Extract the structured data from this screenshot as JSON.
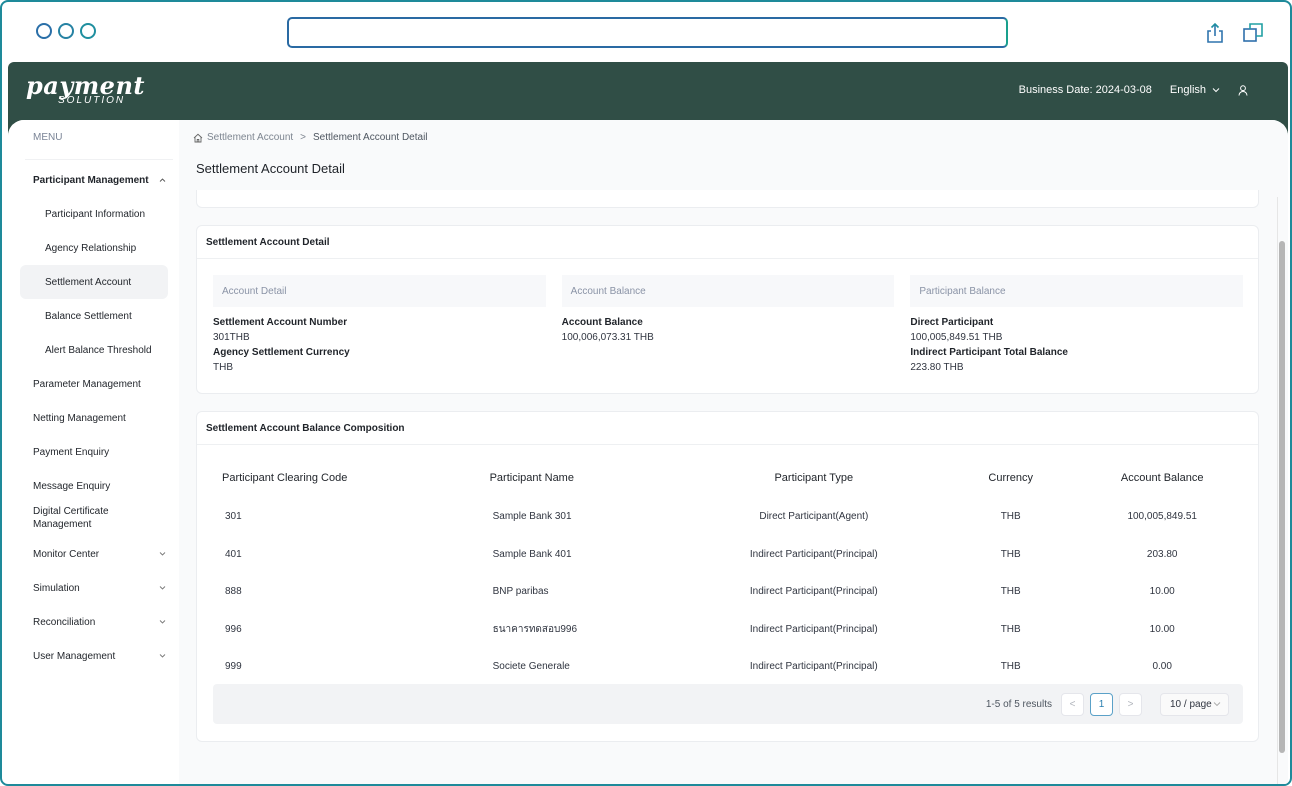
{
  "browser": {
    "url": "",
    "icons": [
      "share-icon",
      "windows-icon"
    ]
  },
  "header": {
    "logo_line1": "payment",
    "logo_line2": "SOLUTION",
    "business_date": "Business Date: 2024-03-08",
    "language": "English",
    "icons": [
      "chevron-down-icon",
      "user-icon"
    ]
  },
  "sidebar": {
    "menu_label": "MENU",
    "items": [
      {
        "label": "Participant Management",
        "level": 0,
        "expanded": true
      },
      {
        "label": "Participant Information",
        "level": 1
      },
      {
        "label": "Agency Relationship",
        "level": 1
      },
      {
        "label": "Settlement Account",
        "level": 1,
        "active": true
      },
      {
        "label": "Balance Settlement",
        "level": 1
      },
      {
        "label": "Alert Balance Threshold",
        "level": 1
      },
      {
        "label": "Parameter Management",
        "level": 0
      },
      {
        "label": "Netting Management",
        "level": 0
      },
      {
        "label": "Payment Enquiry",
        "level": 0
      },
      {
        "label": "Message Enquiry",
        "level": 0
      },
      {
        "label": "Digital Certificate Management",
        "level": 0
      },
      {
        "label": "Monitor Center",
        "level": 0,
        "expandable": true
      },
      {
        "label": "Simulation",
        "level": 0,
        "expandable": true
      },
      {
        "label": "Reconciliation",
        "level": 0,
        "expandable": true
      },
      {
        "label": "User Management",
        "level": 0,
        "expandable": true
      }
    ]
  },
  "breadcrumb": {
    "items": [
      "Settlement Account",
      "Settlement Account Detail"
    ],
    "separator": ">"
  },
  "page": {
    "title": "Settlement Account Detail"
  },
  "detail_card": {
    "title": "Settlement Account Detail",
    "sections": [
      {
        "heading": "Account Detail",
        "fields": [
          {
            "label": "Settlement Account Number",
            "value": "301THB"
          },
          {
            "label": "Agency Settlement Currency",
            "value": "THB"
          }
        ]
      },
      {
        "heading": "Account Balance",
        "fields": [
          {
            "label": "Account Balance",
            "value": "100,006,073.31 THB"
          }
        ]
      },
      {
        "heading": "Participant Balance",
        "fields": [
          {
            "label": "Direct Participant",
            "value": "100,005,849.51 THB"
          },
          {
            "label": "Indirect Participant Total Balance",
            "value": "223.80 THB"
          }
        ]
      }
    ]
  },
  "composition_card": {
    "title": "Settlement Account Balance Composition",
    "columns": [
      "Participant Clearing Code",
      "Participant Name",
      "Participant Type",
      "Currency",
      "Account Balance"
    ],
    "rows": [
      [
        "301",
        "Sample Bank 301",
        "Direct Participant(Agent)",
        "THB",
        "100,005,849.51"
      ],
      [
        "401",
        "Sample Bank 401",
        "Indirect Participant(Principal)",
        "THB",
        "203.80"
      ],
      [
        "888",
        "BNP paribas",
        "Indirect Participant(Principal)",
        "THB",
        "10.00"
      ],
      [
        "996",
        "ธนาคารทดสอบ996",
        "Indirect Participant(Principal)",
        "THB",
        "10.00"
      ],
      [
        "999",
        "Societe Generale",
        "Indirect Participant(Principal)",
        "THB",
        "0.00"
      ]
    ],
    "pagination": {
      "total_text": "1-5 of 5 results",
      "prev": "<",
      "current_page": "1",
      "next": ">",
      "page_size": "10 / page"
    }
  },
  "colors": {
    "header_bg": "#304e46",
    "frame_border": "#1e8a9a",
    "active_nav_bg": "#f2f3f5",
    "pager_current": "#2a7fb0"
  }
}
